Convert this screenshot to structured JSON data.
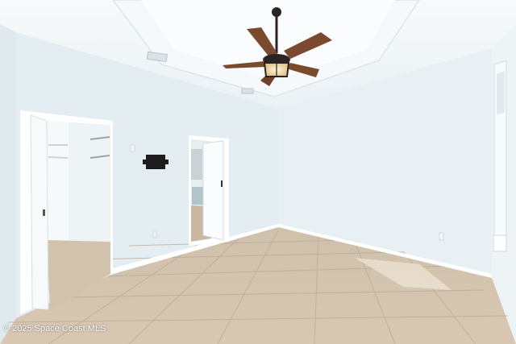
{
  "photo": {
    "description_kind": "real-estate interior photo",
    "watermark": "© 2025 Space Coast MLS"
  },
  "colors": {
    "wall": "#e6eff3",
    "ceiling": "#f4f8fa",
    "floor": "#d9c9b4",
    "fan_blade": "#7b4a2e",
    "fan_metal": "#2a2522"
  }
}
